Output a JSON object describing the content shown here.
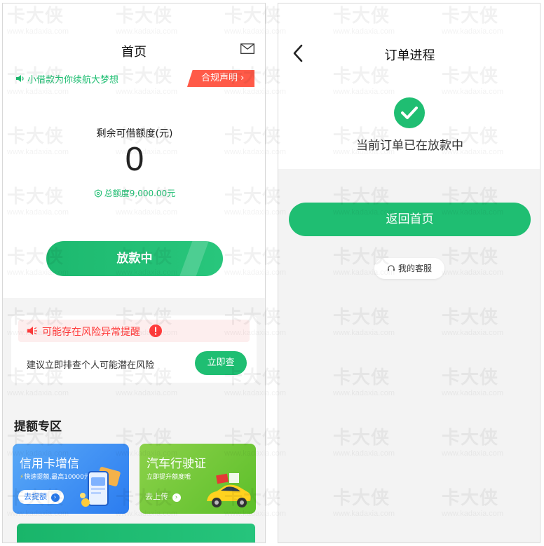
{
  "home": {
    "title": "首页",
    "notice": "小借款为你续航大梦想",
    "compliance_label": "合规声明",
    "remain_label": "剩余可借额度(元)",
    "remain_value": "0",
    "total_label": "总额度9,000.00元",
    "lending_button": "放款中",
    "risk": {
      "title": "可能存在风险异常提醒",
      "description": "建议立即排查个人可能潜在风险",
      "check_button": "立即查"
    },
    "section_title": "提额专区",
    "promos": [
      {
        "title": "信用卡增信",
        "subtitle": "快速提额,最高10000元",
        "button": "去提额"
      },
      {
        "title": "汽车行驶证",
        "subtitle": "立即提升额度哦",
        "button": "去上传"
      }
    ]
  },
  "order": {
    "title": "订单进程",
    "status_text": "当前订单已在放款中",
    "home_button": "返回首页",
    "service_button": "我的客服"
  },
  "watermark": {
    "brand": "卡大侠",
    "url": "www.kadaxia.com"
  },
  "colors": {
    "accent_green": "#1fbe72",
    "alert_red": "#ff3b3b",
    "compliance_orange": "#ff5a48"
  }
}
